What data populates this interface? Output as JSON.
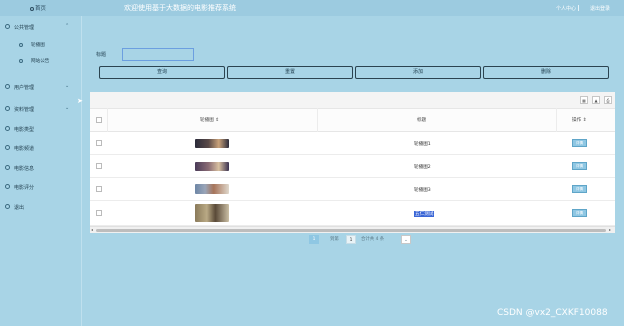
{
  "header": {
    "home_label": "首页",
    "app_title": "欢迎使用基于大数据的电影推荐系统",
    "personal_center": "个人中心",
    "logout": "退出登录"
  },
  "sidebar": {
    "items": [
      {
        "label": "公共管理",
        "expanded": true,
        "children": [
          {
            "label": "轮播图"
          },
          {
            "label": "网站公告"
          }
        ]
      },
      {
        "label": "用户管理",
        "expanded": false
      },
      {
        "label": "资料管理",
        "expanded": false
      },
      {
        "label": "电影类型"
      },
      {
        "label": "电影频道"
      },
      {
        "label": "电影信息"
      },
      {
        "label": "电影评分"
      },
      {
        "label": "退出"
      }
    ]
  },
  "search": {
    "label": "标题",
    "value": "",
    "placeholder": ""
  },
  "actions": {
    "query": "查询",
    "reset": "重置",
    "add": "添加",
    "delete": "删除"
  },
  "table": {
    "columns": [
      "轮播图",
      "标题",
      "操作"
    ],
    "rows": [
      {
        "title": "轮播图1",
        "op": "详情",
        "img_color": "#3a3a4a",
        "img_color2": "#c9a27a"
      },
      {
        "title": "轮播图2",
        "op": "详情",
        "img_color": "#4a3b58",
        "img_color2": "#d8c0a0"
      },
      {
        "title": "轮播图3",
        "op": "详情",
        "img_color": "#6d86a6",
        "img_color2": "#a6745a"
      },
      {
        "title": "五仁测试",
        "op": "详情",
        "img_color": "#8a7a5a",
        "img_color2": "#cbbfa5",
        "selected": true
      }
    ]
  },
  "pagination": {
    "prev_label": "到第",
    "current_page": "1",
    "page_input": "1",
    "total_label": "合计共 4 条"
  },
  "watermark": "CSDN @vx2_CXKF10088",
  "colors": {
    "background": "#a8d4e6",
    "accent": "#8fc7e3",
    "selection": "#3a66d6"
  }
}
